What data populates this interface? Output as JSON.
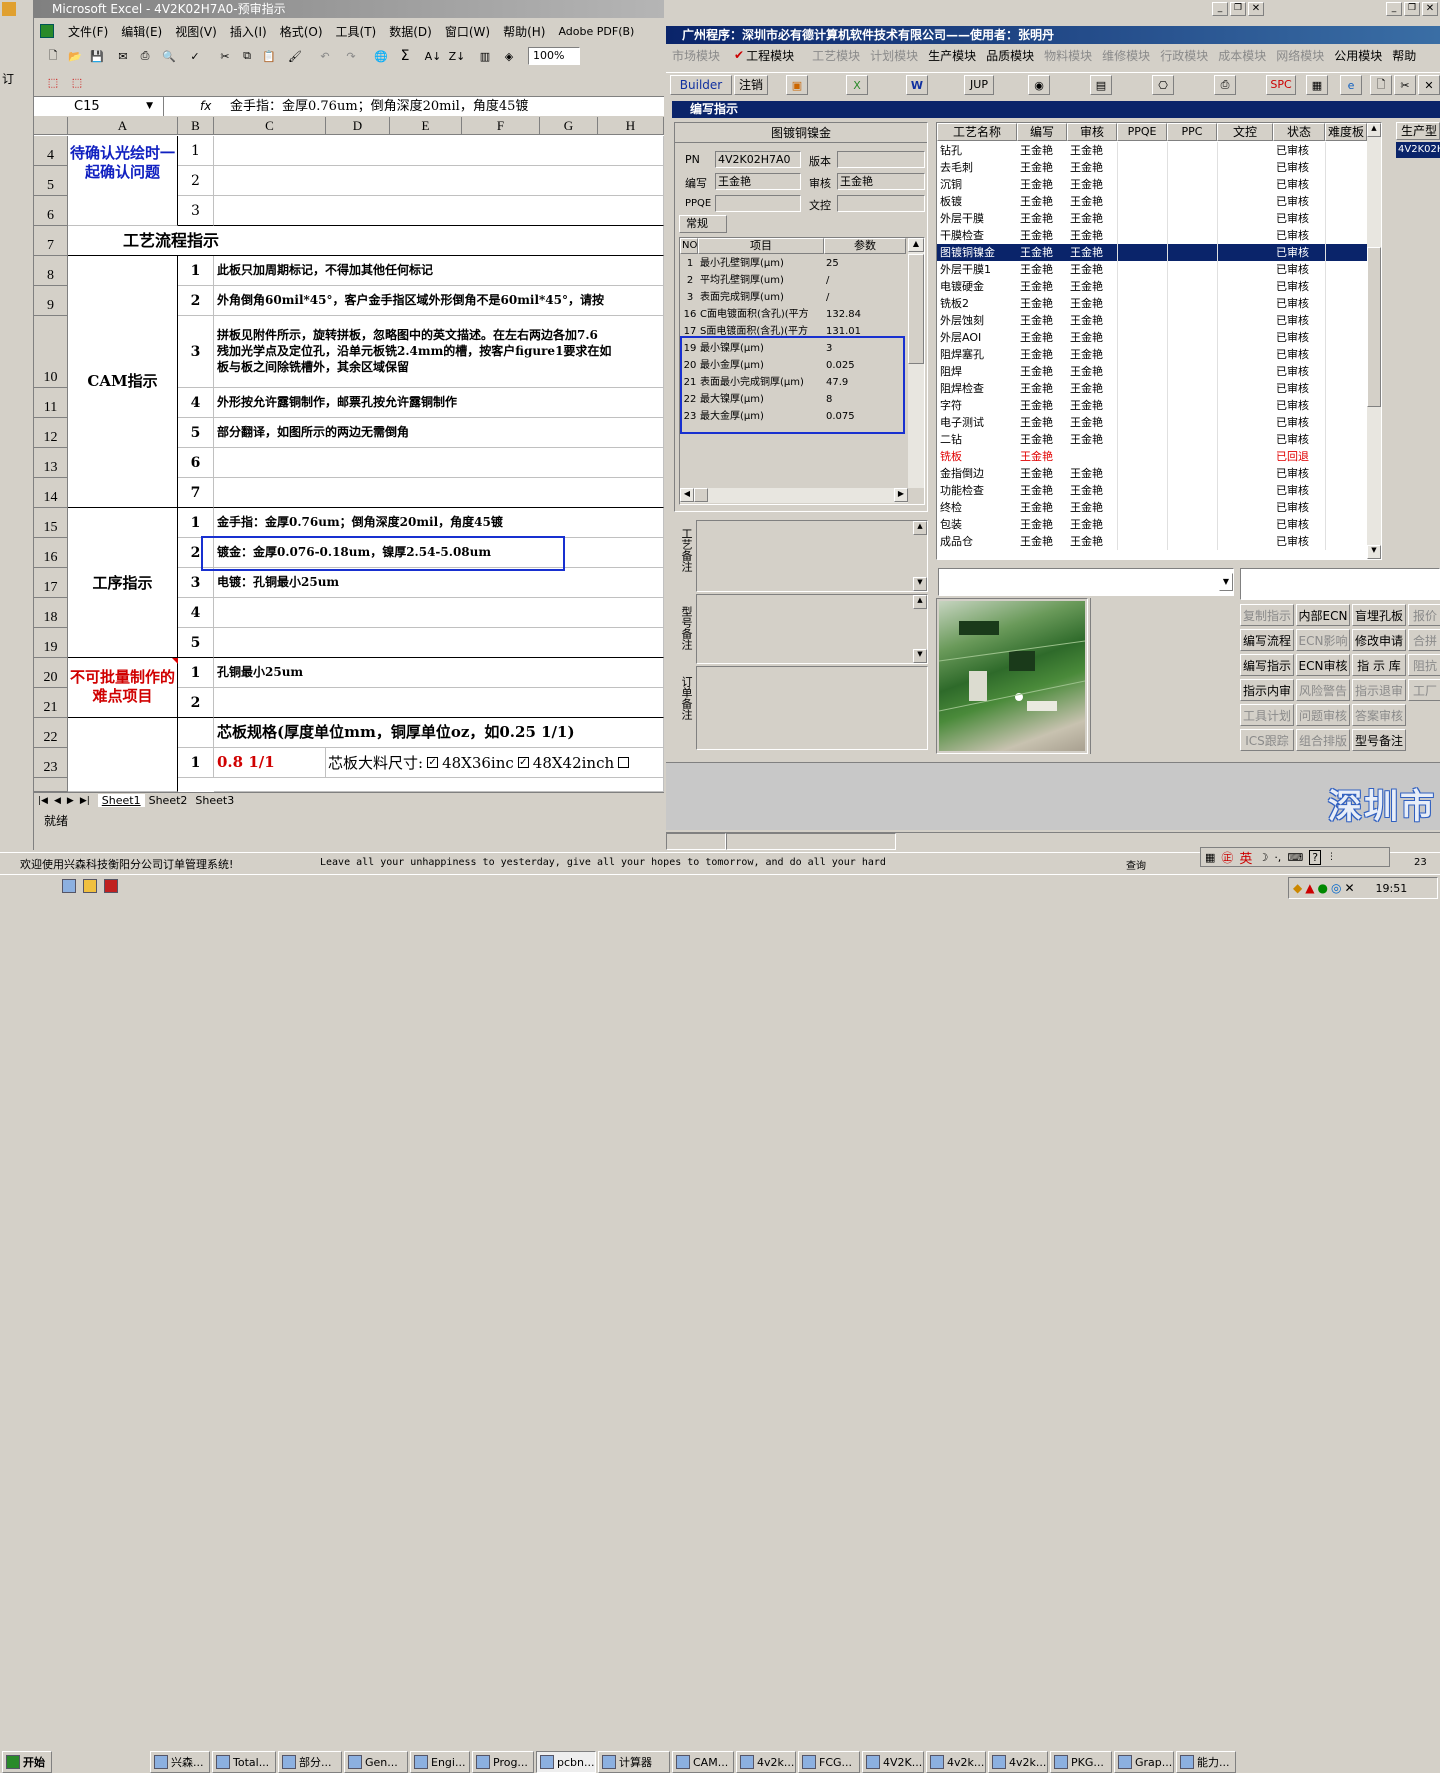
{
  "excel": {
    "title": "Microsoft Excel - 4V2K02H7A0-预审指示",
    "menu": [
      "文件(F)",
      "编辑(E)",
      "视图(V)",
      "插入(I)",
      "格式(O)",
      "工具(T)",
      "数据(D)",
      "窗口(W)",
      "帮助(H)",
      "Adobe PDF(B)"
    ],
    "zoom": "100%",
    "name_box": "C15",
    "formula": "金手指：金厚0.76um；倒角深度20mil，角度45镀",
    "columns": [
      "A",
      "B",
      "C",
      "D",
      "E",
      "F",
      "G",
      "H"
    ],
    "rows": [
      {
        "num": "4",
        "b": "1",
        "c": ""
      },
      {
        "num": "5",
        "b": "2",
        "c": ""
      },
      {
        "num": "6",
        "b": "3",
        "c": ""
      },
      {
        "num": "7",
        "b": "",
        "c": ""
      },
      {
        "num": "8",
        "b": "1",
        "c": "此板只加周期标记，不得加其他任何标记"
      },
      {
        "num": "9",
        "b": "2",
        "c": "外角倒角60mil*45°，客户金手指区域外形倒角不是60mil*45°，请按"
      },
      {
        "num": "10",
        "b": "3",
        "c": "拼板见附件所示，旋转拼板，忽略图中的英文描述。在左右两边各加7.6"
      },
      {
        "num": "11",
        "b": "4",
        "c": "外形按允许露铜制作，邮票孔按允许露铜制作"
      },
      {
        "num": "12",
        "b": "5",
        "c": "部分翻译，如图所示的两边无需倒角"
      },
      {
        "num": "13",
        "b": "6",
        "c": ""
      },
      {
        "num": "14",
        "b": "7",
        "c": ""
      },
      {
        "num": "15",
        "b": "1",
        "c": "金手指：金厚0.76um；倒角深度20mil，角度45镀"
      },
      {
        "num": "16",
        "b": "2",
        "c": "镀金：金厚0.076-0.18um，镍厚2.54-5.08um"
      },
      {
        "num": "17",
        "b": "3",
        "c": "电镀：孔铜最小25um"
      },
      {
        "num": "18",
        "b": "4",
        "c": ""
      },
      {
        "num": "19",
        "b": "5",
        "c": ""
      },
      {
        "num": "20",
        "b": "1",
        "c": "孔铜最小25um"
      },
      {
        "num": "21",
        "b": "2",
        "c": ""
      },
      {
        "num": "22",
        "b": "",
        "c": ""
      },
      {
        "num": "23",
        "b": "1",
        "c": "0.8 1/1"
      }
    ],
    "row10_line2": "残加光学点及定位孔，沿单元板铣2.4mm的槽，按客户figure1要求在如",
    "row10_line3": "板与板之间除铣槽外，其余区域保留",
    "a_labels": {
      "confirm": "待确认光绘时一起确认问题",
      "process": "工艺流程指示",
      "cam": "CAM指示",
      "proc": "工序指示",
      "hard": "不可批量制作的难点项目"
    },
    "core_spec": "芯板规格(厚度单位mm，铜厚单位oz，如0.25 1/1)",
    "core_size_label": "芯板大料尺寸:",
    "core_opt1": "48X36inc",
    "core_opt2": "48X42inch",
    "sheets": [
      "Sheet1",
      "Sheet2",
      "Sheet3"
    ],
    "status": "就绪"
  },
  "app": {
    "title": "广州程序：深圳市必有德计算机软件技术有限公司——使用者：张明丹",
    "modules": [
      "市场模块",
      "工程模块",
      "工艺模块",
      "计划模块",
      "生产模块",
      "品质模块",
      "物料模块",
      "维修模块",
      "行政模块",
      "成本模块",
      "网络模块",
      "公用模块",
      "帮助"
    ],
    "toolbar": {
      "builder": "Builder",
      "logout": "注销",
      "jup": "JUP",
      "spc": "SPC"
    },
    "sub_title": "编写指示",
    "section": "图镀铜镍金",
    "pn_label": "PN",
    "pn_value": "4V2K02H7A0",
    "version_label": "版本",
    "version_value": "",
    "writer_label": "编写",
    "writer_value": "王金艳",
    "review_label": "审核",
    "review_value": "王金艳",
    "ppqe_label": "PPQE",
    "ppqe_value": "",
    "doc_label": "文控",
    "doc_value": "",
    "tab": "常规",
    "param_headers": [
      "NO",
      "项目",
      "参数"
    ],
    "params": [
      [
        "1",
        "最小孔壁铜厚(μm)",
        "25"
      ],
      [
        "2",
        "平均孔壁铜厚(um)",
        "/"
      ],
      [
        "3",
        "表面完成铜厚(um)",
        "/"
      ],
      [
        "16",
        "C面电镀面积(含孔)(平方",
        "132.84"
      ],
      [
        "17",
        "S面电镀面积(含孔)(平方",
        "131.01"
      ],
      [
        "19",
        "最小镍厚(μm)",
        "3"
      ],
      [
        "20",
        "最小金厚(μm)",
        "0.025"
      ],
      [
        "21",
        "表面最小完成铜厚(μm)",
        "47.9"
      ],
      [
        "22",
        "最大镍厚(μm)",
        "8"
      ],
      [
        "23",
        "最大金厚(μm)",
        "0.075"
      ]
    ],
    "note_labels": [
      "工艺备注",
      "型号备注",
      "订单备注"
    ],
    "grid_headers": [
      "工艺名称",
      "编写",
      "审核",
      "PPQE",
      "PPC",
      "文控",
      "状态",
      "难度板"
    ],
    "grid_rows": [
      [
        "钻孔",
        "王金艳",
        "王金艳",
        "已审核"
      ],
      [
        "去毛刺",
        "王金艳",
        "王金艳",
        "已审核"
      ],
      [
        "沉铜",
        "王金艳",
        "王金艳",
        "已审核"
      ],
      [
        "板镀",
        "王金艳",
        "王金艳",
        "已审核"
      ],
      [
        "外层干膜",
        "王金艳",
        "王金艳",
        "已审核"
      ],
      [
        "干膜检查",
        "王金艳",
        "王金艳",
        "已审核"
      ],
      [
        "图镀铜镍金",
        "王金艳",
        "王金艳",
        "已审核"
      ],
      [
        "外层干膜1",
        "王金艳",
        "王金艳",
        "已审核"
      ],
      [
        "电镀硬金",
        "王金艳",
        "王金艳",
        "已审核"
      ],
      [
        "铣板2",
        "王金艳",
        "王金艳",
        "已审核"
      ],
      [
        "外层蚀刻",
        "王金艳",
        "王金艳",
        "已审核"
      ],
      [
        "外层AOI",
        "王金艳",
        "王金艳",
        "已审核"
      ],
      [
        "阻焊塞孔",
        "王金艳",
        "王金艳",
        "已审核"
      ],
      [
        "阻焊",
        "王金艳",
        "王金艳",
        "已审核"
      ],
      [
        "阻焊检查",
        "王金艳",
        "王金艳",
        "已审核"
      ],
      [
        "字符",
        "王金艳",
        "王金艳",
        "已审核"
      ],
      [
        "电子测试",
        "王金艳",
        "王金艳",
        "已审核"
      ],
      [
        "二钻",
        "王金艳",
        "王金艳",
        "已审核"
      ],
      [
        "铣板",
        "王金艳",
        "",
        "已回退"
      ],
      [
        "金指倒边",
        "王金艳",
        "王金艳",
        "已审核"
      ],
      [
        "功能检查",
        "王金艳",
        "王金艳",
        "已审核"
      ],
      [
        "终检",
        "王金艳",
        "王金艳",
        "已审核"
      ],
      [
        "包装",
        "王金艳",
        "王金艳",
        "已审核"
      ],
      [
        "成品仓",
        "王金艳",
        "王金艳",
        "已审核"
      ]
    ],
    "side_header": "生产型",
    "side_value": "4V2K02H",
    "buttons": [
      [
        "复制指示",
        "内部ECN",
        "盲埋孔板",
        "报价"
      ],
      [
        "编写流程",
        "ECN影响",
        "修改申请",
        "合拼"
      ],
      [
        "编写指示",
        "ECN审核",
        "指 示 库",
        "阻抗"
      ],
      [
        "指示内审",
        "风险警告",
        "指示退审",
        "工厂"
      ],
      [
        "工具计划",
        "问题审核",
        "答案审核",
        ""
      ],
      [
        "ICS跟踪",
        "组合排版",
        "型号备注",
        ""
      ]
    ],
    "brand": "深圳市"
  },
  "statusbar": {
    "welcome": "欢迎使用兴森科技衡阳分公司订单管理系统!",
    "motto": "Leave all your unhappiness to yesterday, give all your hopes to tomorrow, and do all your hard",
    "query": "查询",
    "num": "23"
  },
  "ime": {
    "ying": "英"
  },
  "taskbar": {
    "start": "开始",
    "items": [
      "兴森...",
      "Total...",
      "部分...",
      "Gen...",
      "Engi...",
      "Prog...",
      "pcbn...",
      "计算器",
      "CAM...",
      "4v2k...",
      "FCG...",
      "4V2K...",
      "4v2k...",
      "4v2k...",
      "PKG...",
      "Grap...",
      "能力..."
    ],
    "clock": "19:51"
  }
}
